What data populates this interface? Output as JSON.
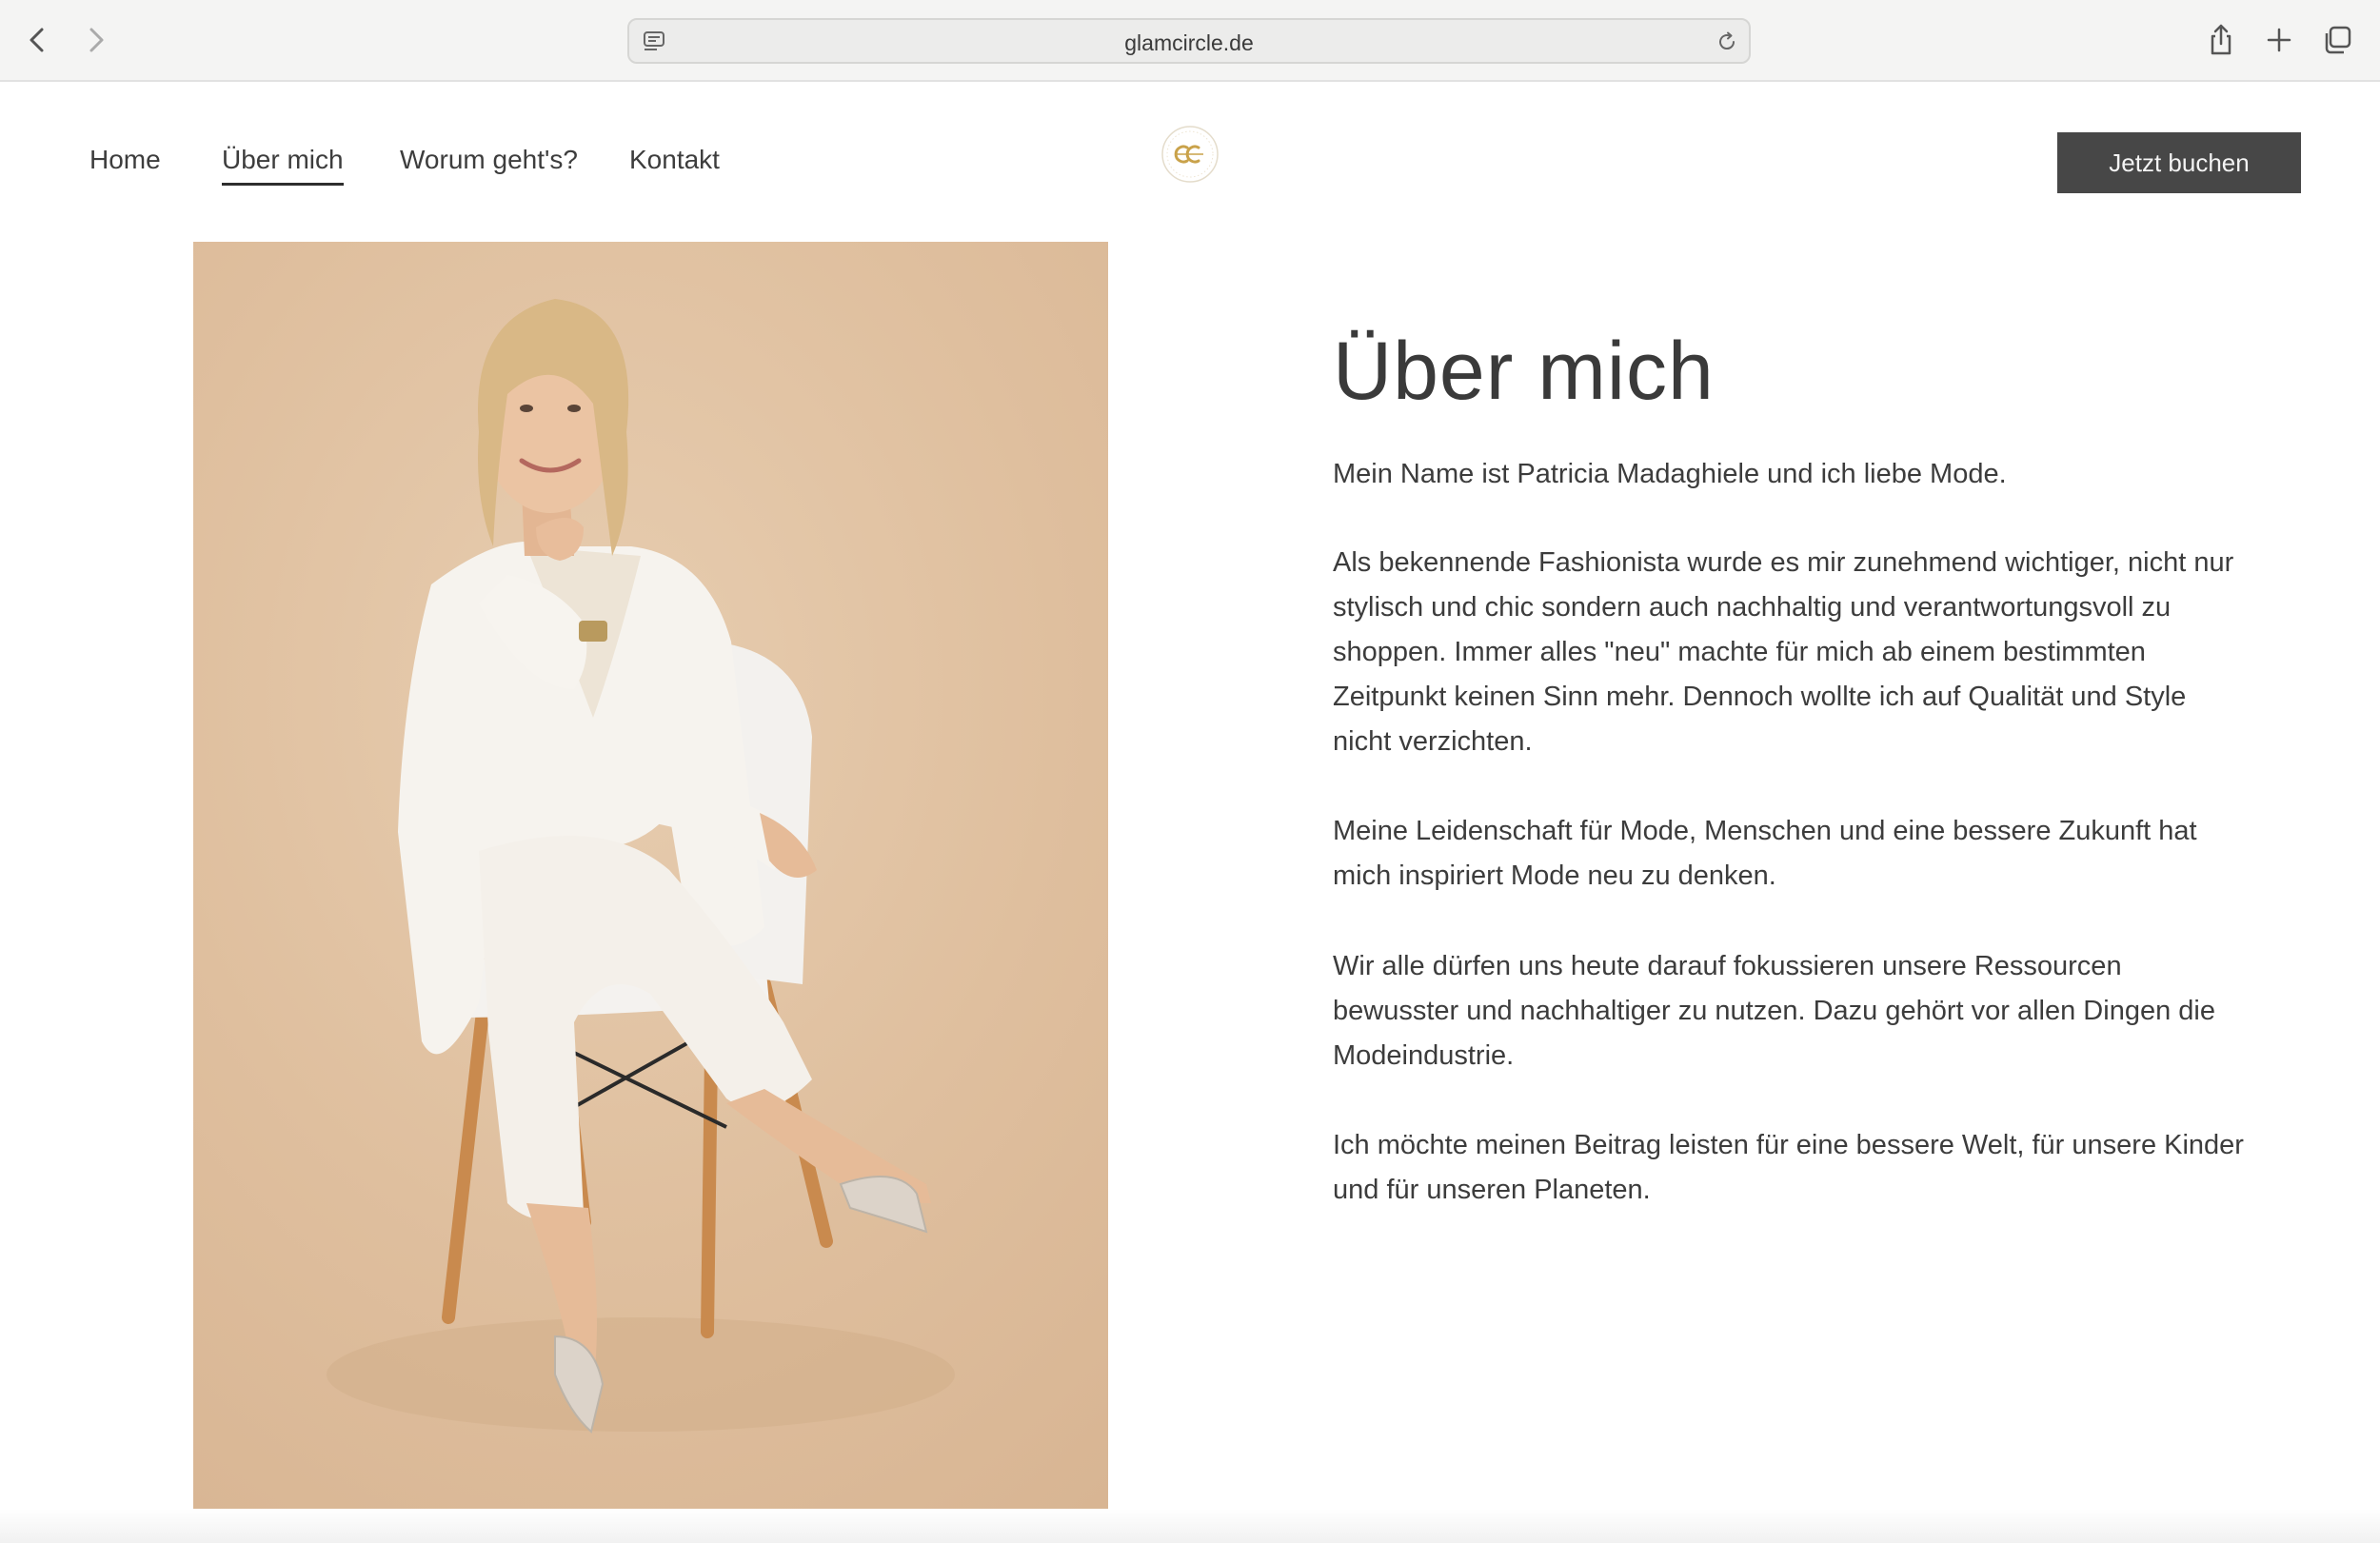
{
  "browser": {
    "url": "glamcircle.de"
  },
  "nav": {
    "items": [
      {
        "label": "Home"
      },
      {
        "label": "Über mich"
      },
      {
        "label": "Worum geht's?"
      },
      {
        "label": "Kontakt"
      }
    ],
    "active_index": 1,
    "cta_label": "Jetzt buchen"
  },
  "logo": {
    "monogram": "GC"
  },
  "about": {
    "title": "Über mich",
    "paragraphs": [
      "Mein Name ist Patricia Madaghiele und ich liebe Mode.",
      "Als bekennende Fashionista wurde es mir zunehmend wichtiger, nicht nur stylisch und chic sondern auch nachhaltig und verantwortungsvoll zu shoppen. Immer alles \"neu\" machte für mich ab einem bestimmten Zeitpunkt keinen Sinn mehr. Dennoch wollte ich auf Qualität und Style nicht verzichten.",
      "Meine Leidenschaft für Mode, Menschen und eine bessere Zukunft hat mich inspiriert Mode neu zu denken.",
      "Wir alle dürfen uns heute darauf fokussieren unsere Ressourcen bewusster und nachhaltiger zu nutzen. Dazu gehört vor allen Dingen die Modeindustrie.",
      "Ich möchte meinen Beitrag leisten für eine bessere Welt, für unsere Kinder und für unseren Planeten."
    ]
  },
  "colors": {
    "photo_background": "#e0c2a2",
    "cta_background": "#474747",
    "logo_gold": "#c9a24a",
    "text": "#3c3c3c"
  },
  "icons": {
    "back": "chevron-left-icon",
    "forward": "chevron-right-icon",
    "page": "page-menu-icon",
    "reload": "reload-icon",
    "share": "share-icon",
    "new_tab": "plus-icon",
    "tabs": "tabs-overview-icon"
  }
}
